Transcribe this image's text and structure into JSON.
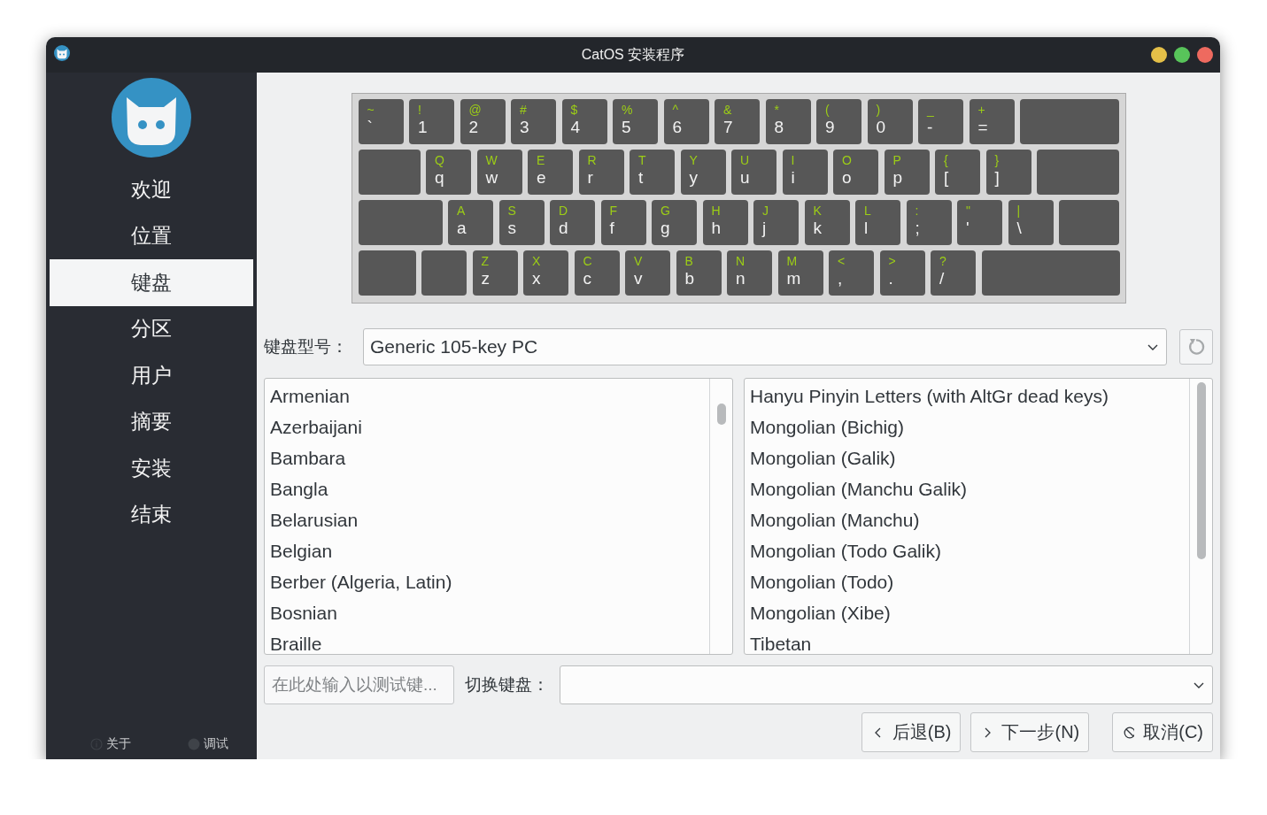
{
  "window": {
    "title": "CatOS 安装程序",
    "controls": [
      {
        "color": "#e4bf48"
      },
      {
        "color": "#58c45a"
      },
      {
        "color": "#ee6a5f"
      }
    ]
  },
  "sidebar": {
    "items": [
      {
        "label": "欢迎",
        "selected": false
      },
      {
        "label": "位置",
        "selected": false
      },
      {
        "label": "键盘",
        "selected": true
      },
      {
        "label": "分区",
        "selected": false
      },
      {
        "label": "用户",
        "selected": false
      },
      {
        "label": "摘要",
        "selected": false
      },
      {
        "label": "安装",
        "selected": false
      },
      {
        "label": "结束",
        "selected": false
      }
    ],
    "footer": [
      {
        "kind": "about",
        "label": "关于"
      },
      {
        "kind": "debug",
        "label": "调试"
      }
    ]
  },
  "keyboard": {
    "rows": [
      {
        "keys": [
          {
            "kind": "char",
            "upper": "~",
            "lower": "`"
          },
          {
            "kind": "char",
            "upper": "!",
            "lower": "1"
          },
          {
            "kind": "char",
            "upper": "@",
            "lower": "2"
          },
          {
            "kind": "char",
            "upper": "#",
            "lower": "3"
          },
          {
            "kind": "char",
            "upper": "$",
            "lower": "4"
          },
          {
            "kind": "char",
            "upper": "%",
            "lower": "5"
          },
          {
            "kind": "char",
            "upper": "^",
            "lower": "6"
          },
          {
            "kind": "char",
            "upper": "&",
            "lower": "7"
          },
          {
            "kind": "char",
            "upper": "*",
            "lower": "8"
          },
          {
            "kind": "char",
            "upper": "(",
            "lower": "9"
          },
          {
            "kind": "char",
            "upper": ")",
            "lower": "0"
          },
          {
            "kind": "char",
            "upper": "_",
            "lower": "-"
          },
          {
            "kind": "char",
            "upper": "+",
            "lower": "="
          },
          {
            "kind": "blank"
          }
        ]
      },
      {
        "keys": [
          {
            "kind": "blank"
          },
          {
            "kind": "char",
            "upper": "Q",
            "lower": "q"
          },
          {
            "kind": "char",
            "upper": "W",
            "lower": "w"
          },
          {
            "kind": "char",
            "upper": "E",
            "lower": "e"
          },
          {
            "kind": "char",
            "upper": "R",
            "lower": "r"
          },
          {
            "kind": "char",
            "upper": "T",
            "lower": "t"
          },
          {
            "kind": "char",
            "upper": "Y",
            "lower": "y"
          },
          {
            "kind": "char",
            "upper": "U",
            "lower": "u"
          },
          {
            "kind": "char",
            "upper": "I",
            "lower": "i"
          },
          {
            "kind": "char",
            "upper": "O",
            "lower": "o"
          },
          {
            "kind": "char",
            "upper": "P",
            "lower": "p"
          },
          {
            "kind": "char",
            "upper": "{",
            "lower": "["
          },
          {
            "kind": "char",
            "upper": "}",
            "lower": "]"
          },
          {
            "kind": "blank"
          }
        ]
      },
      {
        "keys": [
          {
            "kind": "blank"
          },
          {
            "kind": "char",
            "upper": "A",
            "lower": "a"
          },
          {
            "kind": "char",
            "upper": "S",
            "lower": "s"
          },
          {
            "kind": "char",
            "upper": "D",
            "lower": "d"
          },
          {
            "kind": "char",
            "upper": "F",
            "lower": "f"
          },
          {
            "kind": "char",
            "upper": "G",
            "lower": "g"
          },
          {
            "kind": "char",
            "upper": "H",
            "lower": "h"
          },
          {
            "kind": "char",
            "upper": "J",
            "lower": "j"
          },
          {
            "kind": "char",
            "upper": "K",
            "lower": "k"
          },
          {
            "kind": "char",
            "upper": "L",
            "lower": "l"
          },
          {
            "kind": "char",
            "upper": ":",
            "lower": ";"
          },
          {
            "kind": "char",
            "upper": "\"",
            "lower": "'"
          },
          {
            "kind": "char",
            "upper": "|",
            "lower": "\\"
          },
          {
            "kind": "blank"
          }
        ]
      },
      {
        "keys": [
          {
            "kind": "blank"
          },
          {
            "kind": "blank"
          },
          {
            "kind": "char",
            "upper": "Z",
            "lower": "z"
          },
          {
            "kind": "char",
            "upper": "X",
            "lower": "x"
          },
          {
            "kind": "char",
            "upper": "C",
            "lower": "c"
          },
          {
            "kind": "char",
            "upper": "V",
            "lower": "v"
          },
          {
            "kind": "char",
            "upper": "B",
            "lower": "b"
          },
          {
            "kind": "char",
            "upper": "N",
            "lower": "n"
          },
          {
            "kind": "char",
            "upper": "M",
            "lower": "m"
          },
          {
            "kind": "char",
            "upper": "<",
            "lower": ","
          },
          {
            "kind": "char",
            "upper": ">",
            "lower": "."
          },
          {
            "kind": "char",
            "upper": "?",
            "lower": "/"
          },
          {
            "kind": "blank"
          }
        ]
      }
    ]
  },
  "model": {
    "label": "键盘型号：",
    "value": "Generic 105-key PC"
  },
  "layouts": [
    {
      "label": "Armenian",
      "selected": false
    },
    {
      "label": "Azerbaijani",
      "selected": false
    },
    {
      "label": "Bambara",
      "selected": false
    },
    {
      "label": "Bangla",
      "selected": false
    },
    {
      "label": "Belarusian",
      "selected": false
    },
    {
      "label": "Belgian",
      "selected": false
    },
    {
      "label": "Berber (Algeria, Latin)",
      "selected": false
    },
    {
      "label": "Bosnian",
      "selected": false
    },
    {
      "label": "Braille",
      "selected": false
    }
  ],
  "variants": [
    {
      "label": "Hanyu Pinyin Letters (with AltGr dead keys)",
      "selected": false
    },
    {
      "label": "Mongolian (Bichig)",
      "selected": false
    },
    {
      "label": "Mongolian (Galik)",
      "selected": false
    },
    {
      "label": "Mongolian (Manchu Galik)",
      "selected": false
    },
    {
      "label": "Mongolian (Manchu)",
      "selected": false
    },
    {
      "label": "Mongolian (Todo Galik)",
      "selected": false
    },
    {
      "label": "Mongolian (Todo)",
      "selected": false
    },
    {
      "label": "Mongolian (Xibe)",
      "selected": false
    },
    {
      "label": "Tibetan",
      "selected": false
    }
  ],
  "test": {
    "placeholder": "在此处输入以测试键..."
  },
  "switch": {
    "label": "切换键盘："
  },
  "buttons": [
    {
      "kind": "back",
      "label": "后退(B)"
    },
    {
      "kind": "next",
      "label": "下一步(N)"
    },
    {
      "kind": "cancel",
      "label": "取消(C)"
    }
  ]
}
